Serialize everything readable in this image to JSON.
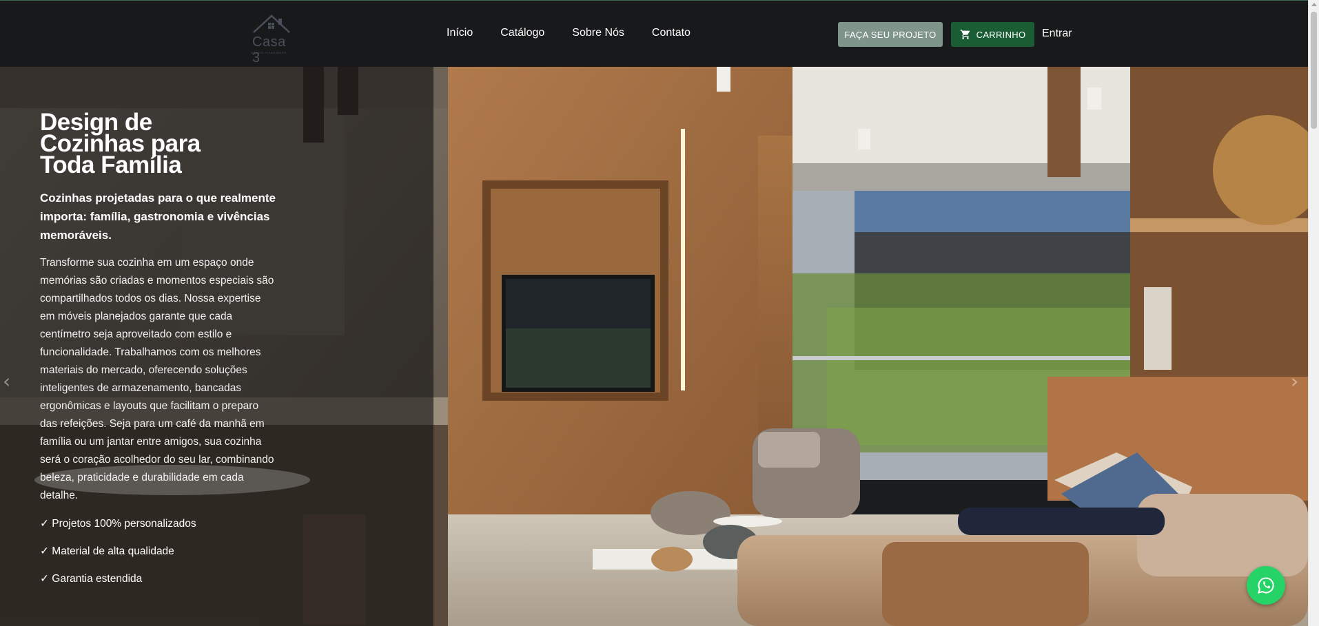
{
  "header": {
    "logo_text": "Casa 3",
    "logo_sub": "MÓVEIS PLANEJADOS",
    "nav": [
      "Início",
      "Catálogo",
      "Sobre Nós",
      "Contato"
    ],
    "btn_projeto": "FAÇA SEU PROJETO",
    "btn_cart": "CARRINHO",
    "entrar": "Entrar"
  },
  "hero": {
    "title": "Design de Cozinhas para Toda Família",
    "subtitle": "Cozinhas projetadas para o que realmente importa: família, gastronomia e vivências memoráveis.",
    "body": "Transforme sua cozinha em um espaço onde memórias são criadas e momentos especiais são compartilhados todos os dias. Nossa expertise em móveis planejados garante que cada centímetro seja aproveitado com estilo e funcionalidade. Trabalhamos com os melhores materiais do mercado, oferecendo soluções inteligentes de armazenamento, bancadas ergonômicas e layouts que facilitam o preparo das refeições. Seja para um café da manhã em família ou um jantar entre amigos, sua cozinha será o coração acolhedor do seu lar, combinando beleza, praticidade e durabilidade em cada detalhe.",
    "features": [
      "✓ Projetos 100% personalizados",
      "✓ Material de alta qualidade",
      "✓ Garantia estendida"
    ]
  },
  "icons": {
    "cart": "cart-icon",
    "whatsapp": "whatsapp-icon",
    "prev": "chevron-left-icon",
    "next": "chevron-right-icon"
  },
  "colors": {
    "header_bg": "#18191b",
    "btn_projeto": "#7f958b",
    "btn_cart": "#1a5c33",
    "whatsapp": "#25d366"
  }
}
